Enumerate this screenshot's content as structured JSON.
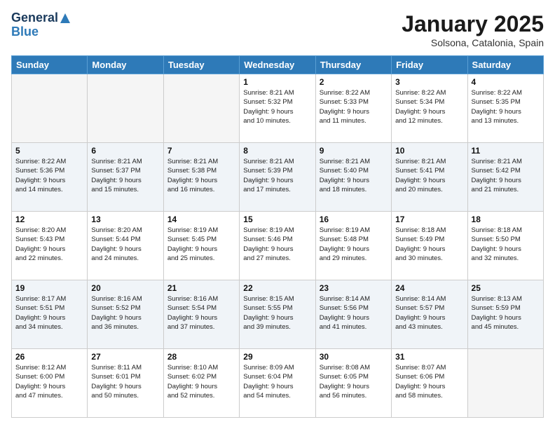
{
  "logo": {
    "line1": "General",
    "line2": "Blue"
  },
  "title": "January 2025",
  "subtitle": "Solsona, Catalonia, Spain",
  "weekdays": [
    "Sunday",
    "Monday",
    "Tuesday",
    "Wednesday",
    "Thursday",
    "Friday",
    "Saturday"
  ],
  "weeks": [
    [
      {
        "day": "",
        "info": ""
      },
      {
        "day": "",
        "info": ""
      },
      {
        "day": "",
        "info": ""
      },
      {
        "day": "1",
        "info": "Sunrise: 8:21 AM\nSunset: 5:32 PM\nDaylight: 9 hours\nand 10 minutes."
      },
      {
        "day": "2",
        "info": "Sunrise: 8:22 AM\nSunset: 5:33 PM\nDaylight: 9 hours\nand 11 minutes."
      },
      {
        "day": "3",
        "info": "Sunrise: 8:22 AM\nSunset: 5:34 PM\nDaylight: 9 hours\nand 12 minutes."
      },
      {
        "day": "4",
        "info": "Sunrise: 8:22 AM\nSunset: 5:35 PM\nDaylight: 9 hours\nand 13 minutes."
      }
    ],
    [
      {
        "day": "5",
        "info": "Sunrise: 8:22 AM\nSunset: 5:36 PM\nDaylight: 9 hours\nand 14 minutes."
      },
      {
        "day": "6",
        "info": "Sunrise: 8:21 AM\nSunset: 5:37 PM\nDaylight: 9 hours\nand 15 minutes."
      },
      {
        "day": "7",
        "info": "Sunrise: 8:21 AM\nSunset: 5:38 PM\nDaylight: 9 hours\nand 16 minutes."
      },
      {
        "day": "8",
        "info": "Sunrise: 8:21 AM\nSunset: 5:39 PM\nDaylight: 9 hours\nand 17 minutes."
      },
      {
        "day": "9",
        "info": "Sunrise: 8:21 AM\nSunset: 5:40 PM\nDaylight: 9 hours\nand 18 minutes."
      },
      {
        "day": "10",
        "info": "Sunrise: 8:21 AM\nSunset: 5:41 PM\nDaylight: 9 hours\nand 20 minutes."
      },
      {
        "day": "11",
        "info": "Sunrise: 8:21 AM\nSunset: 5:42 PM\nDaylight: 9 hours\nand 21 minutes."
      }
    ],
    [
      {
        "day": "12",
        "info": "Sunrise: 8:20 AM\nSunset: 5:43 PM\nDaylight: 9 hours\nand 22 minutes."
      },
      {
        "day": "13",
        "info": "Sunrise: 8:20 AM\nSunset: 5:44 PM\nDaylight: 9 hours\nand 24 minutes."
      },
      {
        "day": "14",
        "info": "Sunrise: 8:19 AM\nSunset: 5:45 PM\nDaylight: 9 hours\nand 25 minutes."
      },
      {
        "day": "15",
        "info": "Sunrise: 8:19 AM\nSunset: 5:46 PM\nDaylight: 9 hours\nand 27 minutes."
      },
      {
        "day": "16",
        "info": "Sunrise: 8:19 AM\nSunset: 5:48 PM\nDaylight: 9 hours\nand 29 minutes."
      },
      {
        "day": "17",
        "info": "Sunrise: 8:18 AM\nSunset: 5:49 PM\nDaylight: 9 hours\nand 30 minutes."
      },
      {
        "day": "18",
        "info": "Sunrise: 8:18 AM\nSunset: 5:50 PM\nDaylight: 9 hours\nand 32 minutes."
      }
    ],
    [
      {
        "day": "19",
        "info": "Sunrise: 8:17 AM\nSunset: 5:51 PM\nDaylight: 9 hours\nand 34 minutes."
      },
      {
        "day": "20",
        "info": "Sunrise: 8:16 AM\nSunset: 5:52 PM\nDaylight: 9 hours\nand 36 minutes."
      },
      {
        "day": "21",
        "info": "Sunrise: 8:16 AM\nSunset: 5:54 PM\nDaylight: 9 hours\nand 37 minutes."
      },
      {
        "day": "22",
        "info": "Sunrise: 8:15 AM\nSunset: 5:55 PM\nDaylight: 9 hours\nand 39 minutes."
      },
      {
        "day": "23",
        "info": "Sunrise: 8:14 AM\nSunset: 5:56 PM\nDaylight: 9 hours\nand 41 minutes."
      },
      {
        "day": "24",
        "info": "Sunrise: 8:14 AM\nSunset: 5:57 PM\nDaylight: 9 hours\nand 43 minutes."
      },
      {
        "day": "25",
        "info": "Sunrise: 8:13 AM\nSunset: 5:59 PM\nDaylight: 9 hours\nand 45 minutes."
      }
    ],
    [
      {
        "day": "26",
        "info": "Sunrise: 8:12 AM\nSunset: 6:00 PM\nDaylight: 9 hours\nand 47 minutes."
      },
      {
        "day": "27",
        "info": "Sunrise: 8:11 AM\nSunset: 6:01 PM\nDaylight: 9 hours\nand 50 minutes."
      },
      {
        "day": "28",
        "info": "Sunrise: 8:10 AM\nSunset: 6:02 PM\nDaylight: 9 hours\nand 52 minutes."
      },
      {
        "day": "29",
        "info": "Sunrise: 8:09 AM\nSunset: 6:04 PM\nDaylight: 9 hours\nand 54 minutes."
      },
      {
        "day": "30",
        "info": "Sunrise: 8:08 AM\nSunset: 6:05 PM\nDaylight: 9 hours\nand 56 minutes."
      },
      {
        "day": "31",
        "info": "Sunrise: 8:07 AM\nSunset: 6:06 PM\nDaylight: 9 hours\nand 58 minutes."
      },
      {
        "day": "",
        "info": ""
      }
    ]
  ]
}
